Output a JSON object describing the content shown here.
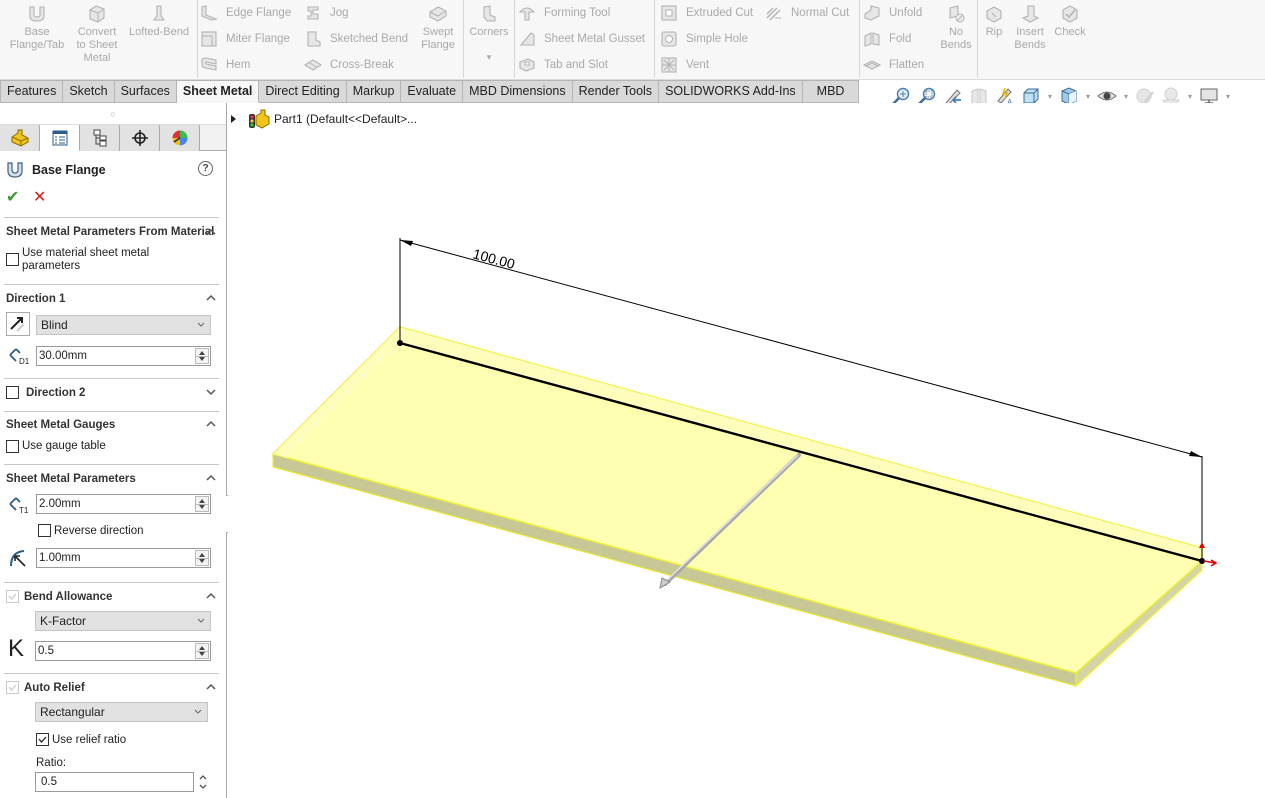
{
  "ribbon": {
    "big_buttons": [
      {
        "id": "base-flange",
        "label": "Base\nFlange/Tab",
        "icon": "base-flange-icon"
      },
      {
        "id": "convert-to-sheet-metal",
        "label": "Convert\nto Sheet\nMetal",
        "icon": "convert-sheet-metal-icon"
      },
      {
        "id": "lofted-bend",
        "label": "Lofted-Bend",
        "icon": "lofted-bend-icon"
      },
      {
        "id": "swept-flange",
        "label": "Swept\nFlange",
        "icon": "swept-flange-icon"
      },
      {
        "id": "corners",
        "label": "Corners",
        "icon": "corners-icon"
      },
      {
        "id": "no-bends",
        "label": "No\nBends",
        "icon": "no-bends-icon"
      },
      {
        "id": "rip",
        "label": "Rip",
        "icon": "rip-icon"
      },
      {
        "id": "insert-bends",
        "label": "Insert\nBends",
        "icon": "insert-bends-icon"
      },
      {
        "id": "check",
        "label": "Check",
        "icon": "check-icon"
      }
    ],
    "small_buttons": {
      "edge_flange": "Edge Flange",
      "miter_flange": "Miter Flange",
      "hem": "Hem",
      "jog": "Jog",
      "sketched_bend": "Sketched Bend",
      "cross_break": "Cross-Break",
      "forming_tool": "Forming Tool",
      "sheet_metal_gusset": "Sheet Metal Gusset",
      "tab_and_slot": "Tab and Slot",
      "extruded_cut": "Extruded Cut",
      "simple_hole": "Simple Hole",
      "vent": "Vent",
      "normal_cut": "Normal Cut",
      "unfold": "Unfold",
      "fold": "Fold",
      "flatten": "Flatten"
    },
    "corners_dropdown": "▾"
  },
  "tabs": [
    {
      "label": "Features",
      "active": false
    },
    {
      "label": "Sketch",
      "active": false
    },
    {
      "label": "Surfaces",
      "active": false
    },
    {
      "label": "Sheet Metal",
      "active": true
    },
    {
      "label": "Direct Editing",
      "active": false
    },
    {
      "label": "Markup",
      "active": false
    },
    {
      "label": "Evaluate",
      "active": false
    },
    {
      "label": "MBD Dimensions",
      "active": false
    },
    {
      "label": "Render Tools",
      "active": false
    },
    {
      "label": "SOLIDWORKS Add-Ins",
      "active": false
    },
    {
      "label": "MBD",
      "active": false
    }
  ],
  "view_toolbar": [
    "zoom-to-fit-icon",
    "zoom-to-area-icon",
    "previous-view-icon",
    "section-view-icon",
    "dynamic-annotation-icon",
    "view-orientation-icon",
    "display-style-icon",
    "hide-show-items-icon",
    "edit-appearance-icon",
    "apply-scene-icon",
    "view-settings-icon"
  ],
  "panel": {
    "grip": "○",
    "feature_title": "Base Flange",
    "help": "?",
    "ok": "✔",
    "cancel": "✕",
    "sections": {
      "sm_from_material": {
        "title": "Sheet Metal Parameters From Material",
        "checkbox_label_1": "Use material sheet metal",
        "checkbox_label_2": "parameters",
        "checked": false
      },
      "direction1": {
        "title": "Direction 1",
        "end_condition": "Blind",
        "depth": "30.00mm"
      },
      "direction2": {
        "title": "Direction 2",
        "checked": false
      },
      "gauges": {
        "title": "Sheet Metal Gauges",
        "checkbox_label": "Use gauge table",
        "checked": false
      },
      "sm_params": {
        "title": "Sheet Metal Parameters",
        "thickness": "2.00mm",
        "reverse_label": "Reverse direction",
        "reverse_checked": false,
        "bend_radius": "1.00mm"
      },
      "bend_allowance": {
        "title": "Bend Allowance",
        "type": "K-Factor",
        "k_symbol": "K",
        "k_value": "0.5"
      },
      "auto_relief": {
        "title": "Auto Relief",
        "type": "Rectangular",
        "use_ratio_label": "Use relief ratio",
        "use_ratio_checked": true,
        "ratio_label": "Ratio:",
        "ratio_value": "0.5"
      }
    }
  },
  "viewport": {
    "tree_label": "Part1  (Default<<Default>...",
    "dimension_value": "100.00",
    "colors": {
      "part_fill": "#ffffb0",
      "part_side": "#c8c896",
      "part_edge": "#f0f000",
      "sketch_line": "#000000",
      "origin_arrow": "#e00000"
    }
  }
}
